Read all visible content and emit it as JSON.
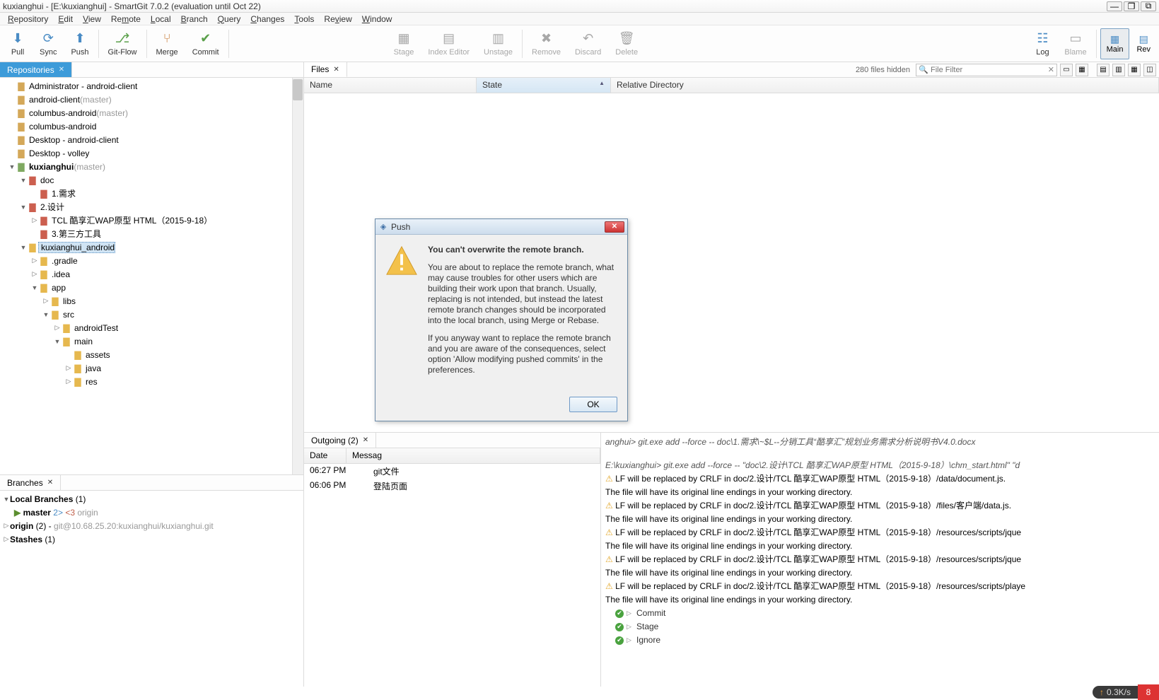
{
  "window": {
    "title": "kuxianghui - [E:\\kuxianghui] - SmartGit 7.0.2 (evaluation until Oct 22)"
  },
  "menu": [
    "Repository",
    "Edit",
    "View",
    "Remote",
    "Local",
    "Branch",
    "Query",
    "Changes",
    "Tools",
    "Review",
    "Window"
  ],
  "toolbar": {
    "pull": "Pull",
    "sync": "Sync",
    "push": "Push",
    "gitflow": "Git-Flow",
    "merge": "Merge",
    "commit": "Commit",
    "stage": "Stage",
    "indexed": "Index Editor",
    "unstage": "Unstage",
    "remove": "Remove",
    "discard": "Discard",
    "delete": "Delete",
    "log": "Log",
    "blame": "Blame",
    "main": "Main",
    "rev": "Rev"
  },
  "tabs": {
    "repos": "Repositories",
    "files": "Files",
    "branches": "Branches",
    "outgoing": "Outgoing (2)"
  },
  "repos": [
    {
      "indent": 0,
      "tw": "",
      "ic": "repoic",
      "label": "Administrator - android-client",
      "muted": ""
    },
    {
      "indent": 0,
      "tw": "",
      "ic": "repoic",
      "label": "android-client",
      "muted": "(master)"
    },
    {
      "indent": 0,
      "tw": "",
      "ic": "repoic",
      "label": "columbus-android",
      "muted": "(master)"
    },
    {
      "indent": 0,
      "tw": "",
      "ic": "repoic",
      "label": "columbus-android",
      "muted": ""
    },
    {
      "indent": 0,
      "tw": "",
      "ic": "repoic",
      "label": "Desktop - android-client",
      "muted": ""
    },
    {
      "indent": 0,
      "tw": "",
      "ic": "repoic",
      "label": "Desktop - volley",
      "muted": ""
    },
    {
      "indent": 0,
      "tw": "▼",
      "ic": "fld-g",
      "label": "kuxianghui",
      "muted": "(master)",
      "bold": true
    },
    {
      "indent": 1,
      "tw": "▼",
      "ic": "fld-r",
      "label": "doc",
      "muted": ""
    },
    {
      "indent": 2,
      "tw": "",
      "ic": "fld-r",
      "label": "1.需求",
      "muted": ""
    },
    {
      "indent": 1,
      "tw": "▼",
      "ic": "fld-r",
      "label": "2.设计",
      "muted": ""
    },
    {
      "indent": 2,
      "tw": "▷",
      "ic": "fld-r",
      "label": "TCL 酷享汇WAP原型 HTML（2015-9-18）",
      "muted": ""
    },
    {
      "indent": 2,
      "tw": "",
      "ic": "fld-r",
      "label": "3.第三方工具",
      "muted": ""
    },
    {
      "indent": 1,
      "tw": "▼",
      "ic": "fld-y",
      "label": "kuxianghui_android",
      "muted": "",
      "sel": true
    },
    {
      "indent": 2,
      "tw": "▷",
      "ic": "fld-y",
      "label": ".gradle",
      "muted": ""
    },
    {
      "indent": 2,
      "tw": "▷",
      "ic": "fld-y",
      "label": ".idea",
      "muted": ""
    },
    {
      "indent": 2,
      "tw": "▼",
      "ic": "fld-y",
      "label": "app",
      "muted": ""
    },
    {
      "indent": 3,
      "tw": "▷",
      "ic": "fld-y",
      "label": "libs",
      "muted": ""
    },
    {
      "indent": 3,
      "tw": "▼",
      "ic": "fld-y",
      "label": "src",
      "muted": ""
    },
    {
      "indent": 4,
      "tw": "▷",
      "ic": "fld-y",
      "label": "androidTest",
      "muted": ""
    },
    {
      "indent": 4,
      "tw": "▼",
      "ic": "fld-y",
      "label": "main",
      "muted": ""
    },
    {
      "indent": 5,
      "tw": "",
      "ic": "fld-y",
      "label": "assets",
      "muted": ""
    },
    {
      "indent": 5,
      "tw": "▷",
      "ic": "fld-y",
      "label": "java",
      "muted": ""
    },
    {
      "indent": 5,
      "tw": "▷",
      "ic": "fld-y",
      "label": "res",
      "muted": ""
    }
  ],
  "branches": {
    "local": {
      "label": "Local Branches",
      "count": "(1)"
    },
    "master": {
      "name": "master",
      "ahead": "2>",
      "behind": "<3",
      "remote": "origin"
    },
    "origin": {
      "label": "origin",
      "count": "(2)",
      "url": "git@10.68.25.20:kuxianghui/kuxianghui.git"
    },
    "stashes": {
      "label": "Stashes",
      "count": "(1)"
    }
  },
  "files": {
    "hidden": "280 files hidden",
    "filter_placeholder": "File Filter",
    "cols": {
      "name": "Name",
      "state": "State",
      "reldir": "Relative Directory"
    }
  },
  "outgoing": {
    "cols": {
      "date": "Date",
      "msg": "Messag"
    },
    "rows": [
      {
        "time": "06:27 PM",
        "msg": "git文件"
      },
      {
        "time": "06:06 PM",
        "msg": "登陆页面"
      }
    ]
  },
  "log": {
    "cmd1": "anghui> git.exe add --force -- doc\\1.需求\\~$L--分销工具“酷享汇”规划业务需求分析说明书V4.0.docx",
    "cmd2": "E:\\kuxianghui> git.exe add --force -- \"doc\\2.设计\\TCL 酷享汇WAP原型 HTML（2015-9-18）\\chm_start.html\" \"d",
    "w1": "LF will be replaced by CRLF in doc/2.设计/TCL 酷享汇WAP原型 HTML（2015-9-18）/data/document.js.",
    "keep": "The file will have its original line endings in your working directory.",
    "w2": "LF will be replaced by CRLF in doc/2.设计/TCL 酷享汇WAP原型 HTML（2015-9-18）/files/客户端/data.js.",
    "w3": "LF will be replaced by CRLF in doc/2.设计/TCL 酷享汇WAP原型 HTML（2015-9-18）/resources/scripts/jque",
    "w4": "LF will be replaced by CRLF in doc/2.设计/TCL 酷享汇WAP原型 HTML（2015-9-18）/resources/scripts/jque",
    "w5": "LF will be replaced by CRLF in doc/2.设计/TCL 酷享汇WAP原型 HTML（2015-9-18）/resources/scripts/playe",
    "ok1": "Commit",
    "ok2": "Stage",
    "ok3": "Ignore"
  },
  "dialog": {
    "title": "Push",
    "heading": "You can't overwrite the remote branch.",
    "p1": "You are about to replace the remote branch, what may cause troubles for other users which are building their work upon that branch. Usually, replacing is not intended, but instead the latest remote branch changes should be incorporated into the local branch, using Merge or Rebase.",
    "p2": "If you anyway want to replace the remote branch and you are aware of the consequences, select option 'Allow modifying pushed commits' in the preferences.",
    "ok": "OK"
  },
  "status": {
    "speed": "0.3K/s",
    "badge": "8"
  }
}
